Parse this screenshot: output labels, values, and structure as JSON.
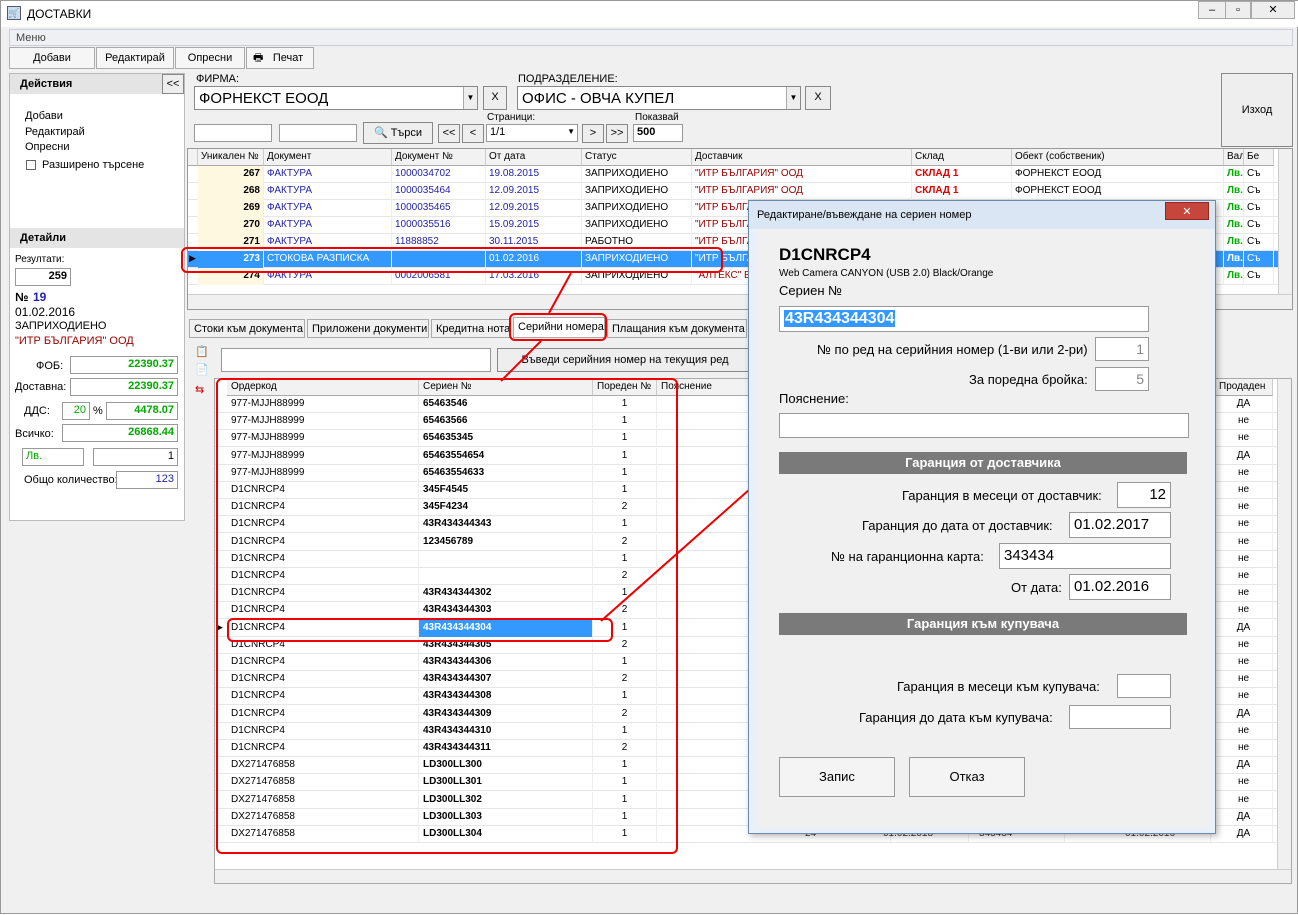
{
  "window": {
    "title": "ДОСТАВКИ",
    "min": "–",
    "max": "▫",
    "close": "✕"
  },
  "menu": {
    "label": "Меню"
  },
  "toolbar": {
    "add": "Добави",
    "edit": "Редактирай",
    "refresh": "Опресни",
    "print": "Печат"
  },
  "left": {
    "actions_title": "Действия",
    "collapse": "<<",
    "links": [
      "Добави",
      "Редактирай",
      "Опресни"
    ],
    "extended_search": "Разширено търсене",
    "details_title": "Детайли",
    "results_label": "Резултати:",
    "results_value": "259",
    "no_prefix": "№",
    "no_value": "19",
    "date": "01.02.2016",
    "status": "ЗАПРИХОДИЕНО",
    "supplier": "\"ИТР БЪЛГАРИЯ\" ООД",
    "fob_label": "ФОБ:",
    "fob_value": "22390.37",
    "delivery_label": "Доставна:",
    "delivery_value": "22390.37",
    "vat_label": "ДДС:",
    "vat_pct": "20",
    "pct_sign": "%",
    "vat_value": "4478.07",
    "total_label": "Всичко:",
    "total_value": "26868.44",
    "currency": "Лв.",
    "rate": "1",
    "qty_label": "Общо количество:",
    "qty_value": "123"
  },
  "filter": {
    "company_label": "ФИРМА:",
    "company_value": "ФОРНЕКСТ ЕООД",
    "division_label": "ПОДРАЗДЕЛЕНИЕ:",
    "division_value": "ОФИС - ОВЧА КУПЕЛ",
    "clear": "X",
    "search_btn": "Търси",
    "first": "<<",
    "prev": "<",
    "next": ">",
    "last": ">>",
    "pages_label": "Страници:",
    "pages_value": "1/1",
    "show_label": "Показвай",
    "show_value": "500",
    "exit": "Изход"
  },
  "grid1": {
    "headers": [
      "Уникален №",
      "Документ",
      "Документ №",
      "От дата",
      "Статус",
      "Доставчик",
      "Склад",
      "Обект (собственик)",
      "Валута",
      "Бе"
    ],
    "rows": [
      [
        "267",
        "ФАКТУРА",
        "1000034702",
        "19.08.2015",
        "ЗАПРИХОДИЕНО",
        "\"ИТР БЪЛГАРИЯ\" ООД",
        "СКЛАД 1",
        "ФОРНЕКСТ ЕООД",
        "Лв.",
        "Съ"
      ],
      [
        "268",
        "ФАКТУРА",
        "1000035464",
        "12.09.2015",
        "ЗАПРИХОДИЕНО",
        "\"ИТР БЪЛГАРИЯ\" ООД",
        "СКЛАД 1",
        "ФОРНЕКСТ ЕООД",
        "Лв.",
        "Съ"
      ],
      [
        "269",
        "ФАКТУРА",
        "1000035465",
        "12.09.2015",
        "ЗАПРИХОДИЕНО",
        "\"ИТР БЪЛГАРИЯ\" ООД",
        "",
        "",
        "Лв.",
        "Съ"
      ],
      [
        "270",
        "ФАКТУРА",
        "1000035516",
        "15.09.2015",
        "ЗАПРИХОДИЕНО",
        "\"ИТР БЪЛГАРИЯ\" ООД",
        "",
        "",
        "Лв.",
        "Съ"
      ],
      [
        "271",
        "ФАКТУРА",
        "11888852",
        "30.11.2015",
        "РАБОТНО",
        "\"ИТР БЪЛГАРИЯ\" ООД",
        "",
        "",
        "Лв.",
        "Съ"
      ],
      [
        "273",
        "СТОКОВА РАЗПИСКА",
        "",
        "01.02.2016",
        "ЗАПРИХОДИЕНО",
        "\"ИТР БЪЛГАРИЯ\" ООД",
        "",
        "",
        "Лв.",
        "Съ"
      ],
      [
        "274",
        "ФАКТУРА",
        "0002006581",
        "17.03.2016",
        "ЗАПРИХОДИЕНО",
        "\"АЛТЕКС\" ЕООД",
        "",
        "",
        "Лв.",
        "Съ"
      ]
    ]
  },
  "tabs": [
    "Стоки към документа",
    "Приложени документи",
    "Кредитна нота",
    "Серийни номера",
    "Плащания към документа"
  ],
  "serial_bar": {
    "enter_btn": "Въведи серийния номер на текущия ред"
  },
  "grid2": {
    "headers": [
      "Ордеркод",
      "Сериен №",
      "Пореден №",
      "Пояснение",
      "Продаден"
    ],
    "rows": [
      [
        "977-MJJH88999",
        "65463546",
        "1",
        "ДА"
      ],
      [
        "977-MJJH88999",
        "65463566",
        "1",
        "не"
      ],
      [
        "977-MJJH88999",
        "654635345",
        "1",
        "не"
      ],
      [
        "977-MJJH88999",
        "65463554654",
        "1",
        "ДА"
      ],
      [
        "977-MJJH88999",
        "65463554633",
        "1",
        "не"
      ],
      [
        "D1CNRCP4",
        "345F4545",
        "1",
        "не"
      ],
      [
        "D1CNRCP4",
        "345F4234",
        "2",
        "не"
      ],
      [
        "D1CNRCP4",
        "43R434344343",
        "1",
        "не"
      ],
      [
        "D1CNRCP4",
        "123456789",
        "2",
        "не"
      ],
      [
        "D1CNRCP4",
        "",
        "1",
        "не"
      ],
      [
        "D1CNRCP4",
        "",
        "2",
        "не"
      ],
      [
        "D1CNRCP4",
        "43R434344302",
        "1",
        "не"
      ],
      [
        "D1CNRCP4",
        "43R434344303",
        "2",
        "не"
      ],
      [
        "D1CNRCP4",
        "43R434344304",
        "1",
        "ДА"
      ],
      [
        "D1CNRCP4",
        "43R434344305",
        "2",
        "не"
      ],
      [
        "D1CNRCP4",
        "43R434344306",
        "1",
        "не"
      ],
      [
        "D1CNRCP4",
        "43R434344307",
        "2",
        "не"
      ],
      [
        "D1CNRCP4",
        "43R434344308",
        "1",
        "не"
      ],
      [
        "D1CNRCP4",
        "43R434344309",
        "2",
        "ДА"
      ],
      [
        "D1CNRCP4",
        "43R434344310",
        "1",
        "не"
      ],
      [
        "D1CNRCP4",
        "43R434344311",
        "2",
        "не"
      ],
      [
        "DX271476858",
        "LD300LL300",
        "1",
        "ДА"
      ],
      [
        "DX271476858",
        "LD300LL301",
        "1",
        "не"
      ],
      [
        "DX271476858",
        "LD300LL302",
        "1",
        "не"
      ],
      [
        "DX271476858",
        "LD300LL303",
        "1",
        "ДА"
      ],
      [
        "DX271476858",
        "LD300LL304",
        "1",
        "ДА"
      ]
    ],
    "hidden_row_tail": [
      "24",
      "01.02.2018",
      "343434",
      "01.02.2016"
    ]
  },
  "dialog": {
    "title": "Редактиране/въвеждане на сериен номер",
    "close": "✕",
    "code": "D1CNRCP4",
    "product": "Web Camera CANYON (USB 2.0) Black/Orange",
    "serial_label": "Сериен №",
    "serial_value": "43R434344304",
    "order_label": "№ по ред на серийния номер (1-ви или 2-ри)",
    "order_value": "1",
    "qty_label": "За поредна бройка:",
    "qty_value": "5",
    "note_label": "Пояснение:",
    "note_value": "",
    "supplier_section": "Гаранция от доставчика",
    "sup_months_label": "Гаранция в месеци от доставчик:",
    "sup_months_value": "12",
    "sup_date_label": "Гаранция до дата от доставчик:",
    "sup_date_value": "01.02.2017",
    "card_label": "№ на гаранционна карта:",
    "card_value": "343434",
    "from_label": "От дата:",
    "from_value": "01.02.2016",
    "buyer_section": "Гаранция към купувача",
    "buy_months_label": "Гаранция в месеци към купувача:",
    "buy_months_value": "",
    "buy_date_label": "Гаранция до дата към купувача:",
    "buy_date_value": "",
    "save": "Запис",
    "cancel": "Отказ"
  }
}
